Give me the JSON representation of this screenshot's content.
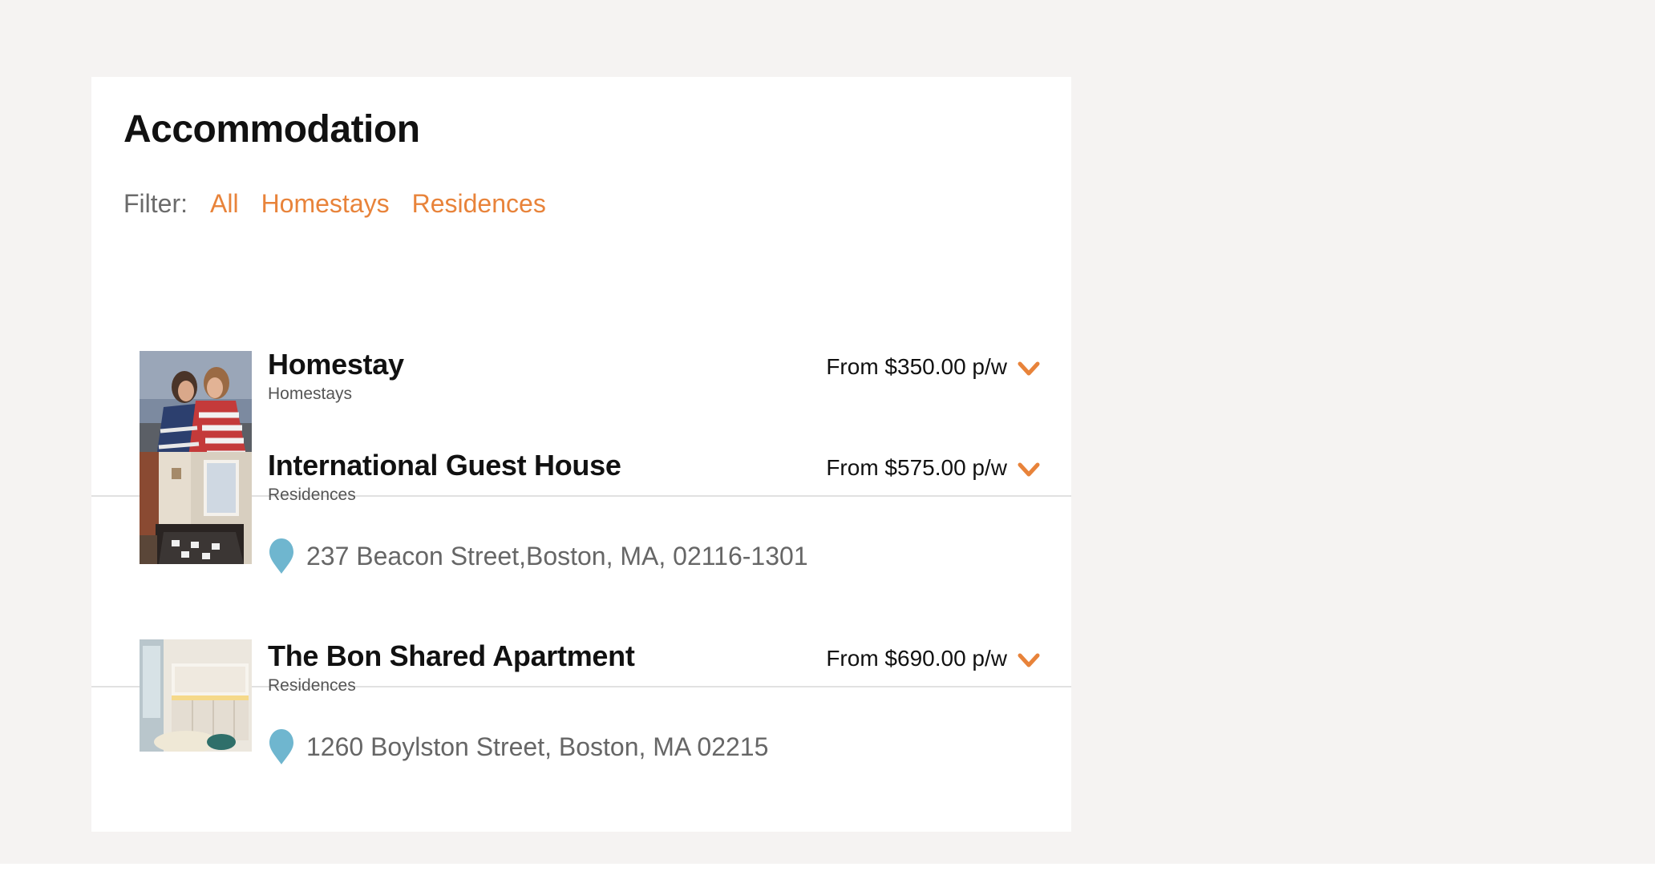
{
  "section": {
    "title": "Accommodation"
  },
  "filter": {
    "label": "Filter:",
    "options": [
      "All",
      "Homestays",
      "Residences"
    ]
  },
  "accent_color": "#e8833a",
  "pin_color": "#6fb6cf",
  "listings": [
    {
      "name": "Homestay",
      "type": "Homestays",
      "price": "From $350.00 p/w",
      "address": "",
      "image": "two-women-with-flag-photo"
    },
    {
      "name": "International Guest House",
      "type": "Residences",
      "price": "From $575.00 p/w",
      "address": "237 Beacon Street,Boston, MA, 02116-1301",
      "image": "bedroom-photo"
    },
    {
      "name": "The Bon Shared Apartment",
      "type": "Residences",
      "price": "From $690.00 p/w",
      "address": "1260 Boylston Street, Boston, MA 02215",
      "image": "kitchen-photo"
    }
  ]
}
